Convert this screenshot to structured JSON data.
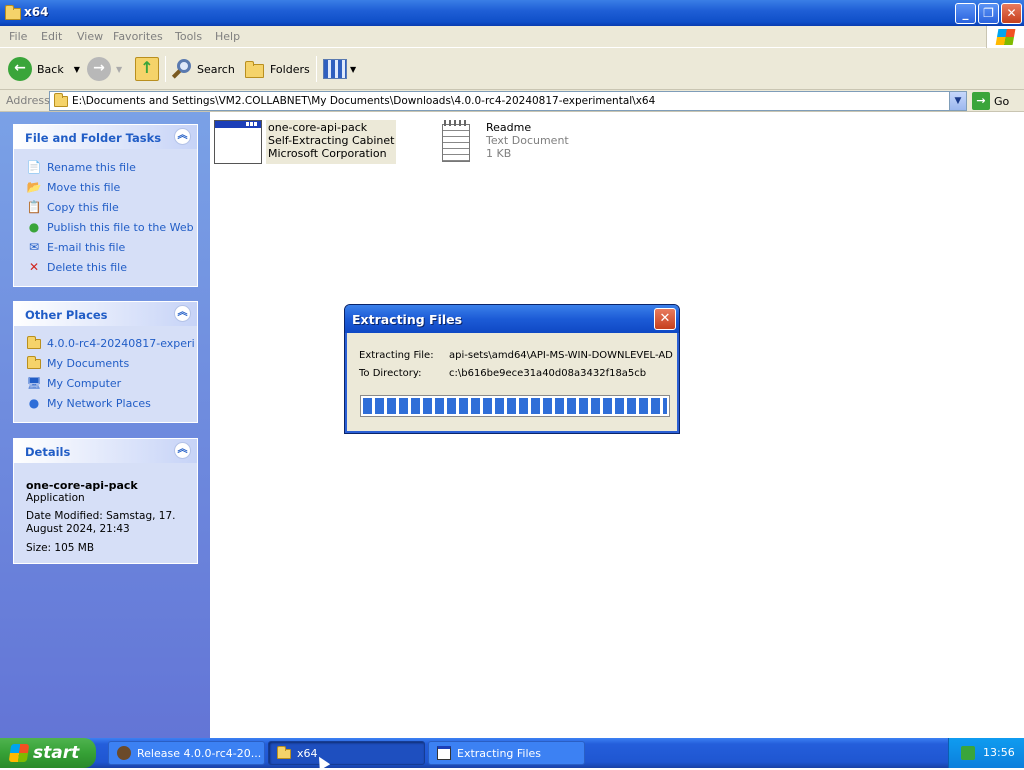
{
  "window": {
    "title": "x64"
  },
  "menu": [
    "File",
    "Edit",
    "View",
    "Favorites",
    "Tools",
    "Help"
  ],
  "toolbar": {
    "back": "Back",
    "search": "Search",
    "folders": "Folders"
  },
  "address": {
    "label": "Address",
    "value": "E:\\Documents and Settings\\VM2.COLLABNET\\My Documents\\Downloads\\4.0.0-rc4-20240817-experimental\\x64",
    "go": "Go"
  },
  "sidebar": {
    "tasks": {
      "title": "File and Folder Tasks",
      "items": [
        "Rename this file",
        "Move this file",
        "Copy this file",
        "Publish this file to the Web",
        "E-mail this file",
        "Delete this file"
      ]
    },
    "places": {
      "title": "Other Places",
      "items": [
        "4.0.0-rc4-20240817-experi",
        "My Documents",
        "My Computer",
        "My Network Places"
      ]
    },
    "details": {
      "title": "Details",
      "name": "one-core-api-pack",
      "type": "Application",
      "modified": "Date Modified: Samstag, 17. August 2024, 21:43",
      "size": "Size: 105 MB"
    }
  },
  "files": [
    {
      "name": "one-core-api-pack",
      "line2": "Self-Extracting Cabinet",
      "line3": "Microsoft Corporation"
    },
    {
      "name": "Readme",
      "line2": "Text Document",
      "line3": "1 KB"
    }
  ],
  "dialog": {
    "title": "Extracting Files",
    "file_label": "Extracting File:",
    "file_value": "api-sets\\amd64\\API-MS-WIN-DOWNLEVEL-AD",
    "dir_label": "To Directory:",
    "dir_value": "c:\\b616be9ece31a40d08a3432f18a5cb",
    "progress": 1.0
  },
  "taskbar": {
    "start": "start",
    "items": [
      "Release 4.0.0-rc4-20...",
      "x64",
      "Extracting Files"
    ],
    "clock": "13:56"
  }
}
